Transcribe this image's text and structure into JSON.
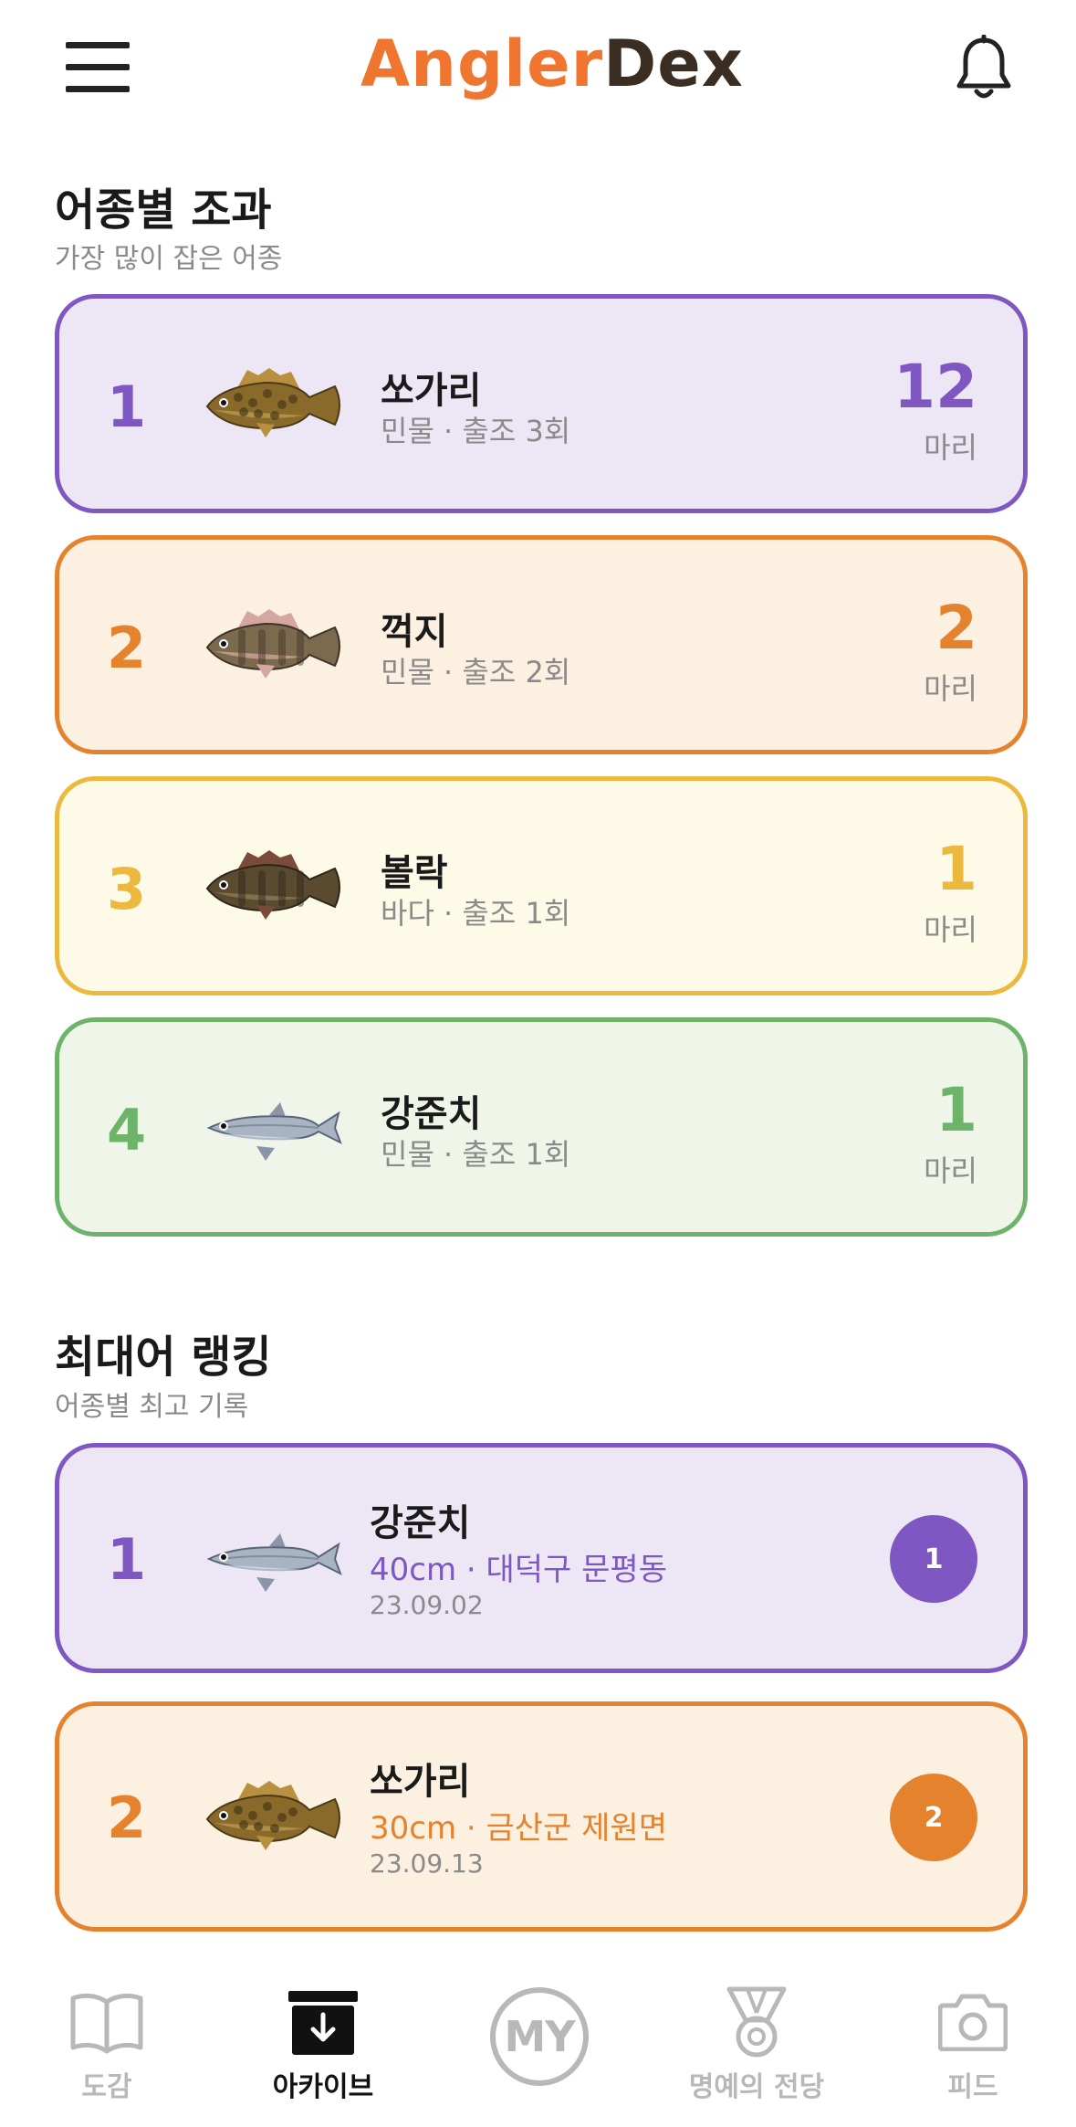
{
  "header": {
    "logo_part1": "Angler",
    "logo_part2": "Dex",
    "menu_icon": "hamburger-menu-icon",
    "bell_icon": "bell-icon"
  },
  "species_section": {
    "title": "어종별 조과",
    "subtitle": "가장 많이 잡은 어종",
    "items": [
      {
        "rank": "1",
        "name": "쏘가리",
        "meta": "민물 · 출조 3회",
        "count": "12",
        "unit": "마리",
        "color": "#7e57c2",
        "bg": "#ece6f5"
      },
      {
        "rank": "2",
        "name": "꺽지",
        "meta": "민물 · 출조 2회",
        "count": "2",
        "unit": "마리",
        "color": "#e5822e",
        "bg": "#fcf0e1"
      },
      {
        "rank": "3",
        "name": "볼락",
        "meta": "바다 · 출조 1회",
        "count": "1",
        "unit": "마리",
        "color": "#ecb93e",
        "bg": "#fdfbe8"
      },
      {
        "rank": "4",
        "name": "강준치",
        "meta": "민물 · 출조 1회",
        "count": "1",
        "unit": "마리",
        "color": "#6db36a",
        "bg": "#f0f5e9"
      }
    ]
  },
  "ranking_section": {
    "title": "최대어 랭킹",
    "subtitle": "어종별 최고 기록",
    "items": [
      {
        "rank": "1",
        "name": "강준치",
        "detail": "40cm · 대덕구 문평동",
        "date": "23.09.02",
        "badge": "1",
        "color": "#7e57c2",
        "bg": "#ece6f5"
      },
      {
        "rank": "2",
        "name": "쏘가리",
        "detail": "30cm · 금산군 제원면",
        "date": "23.09.13",
        "badge": "2",
        "color": "#e5822e",
        "bg": "#fcf0e1"
      }
    ]
  },
  "bottom_nav": {
    "items": [
      {
        "label": "도감",
        "icon": "book-icon",
        "active": false
      },
      {
        "label": "아카이브",
        "icon": "archive-icon",
        "active": true
      },
      {
        "label": "MY",
        "icon": "my-profile-icon",
        "active": false
      },
      {
        "label": "명예의 전당",
        "icon": "medal-icon",
        "active": false
      },
      {
        "label": "피드",
        "icon": "camera-icon",
        "active": false
      }
    ],
    "active_color": "#111111",
    "inactive_color": "#b8b8b8"
  }
}
